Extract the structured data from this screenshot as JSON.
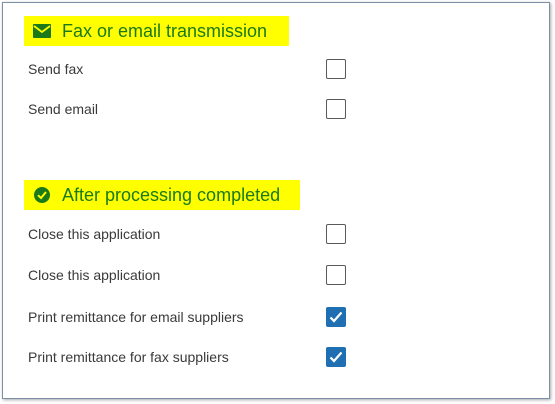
{
  "colors": {
    "highlight": "#ffff00",
    "header_text": "#1a7a1a",
    "checkbox_checked": "#1f6fb2"
  },
  "fax_section": {
    "title": "Fax or email transmission",
    "icon": "envelope-icon",
    "items": [
      {
        "label": "Send fax",
        "checked": false
      },
      {
        "label": "Send email",
        "checked": false
      }
    ]
  },
  "after_section": {
    "title": "After processing completed",
    "icon": "check-circle-icon",
    "items": [
      {
        "label": "Close this application",
        "checked": false
      },
      {
        "label": "Close this application",
        "checked": false
      },
      {
        "label": "Print remittance for email suppliers",
        "checked": true
      },
      {
        "label": "Print remittance for fax suppliers",
        "checked": true
      }
    ]
  }
}
